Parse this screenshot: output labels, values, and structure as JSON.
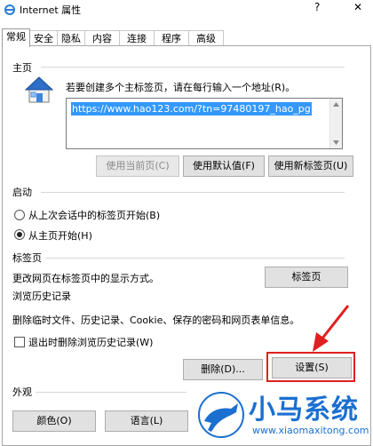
{
  "window": {
    "title": "Internet 属性",
    "help": "?",
    "close": "✕",
    "icon": "internet-explorer-icon"
  },
  "tabs": [
    {
      "label": "常规",
      "active": true
    },
    {
      "label": "安全"
    },
    {
      "label": "隐私"
    },
    {
      "label": "内容"
    },
    {
      "label": "连接"
    },
    {
      "label": "程序"
    },
    {
      "label": "高级"
    }
  ],
  "home": {
    "section": "主页",
    "hint": "若要创建多个主标签页，请在每行输入一个地址(R)。",
    "url": "https://www.hao123.com/?tn=97480197_hao_pg",
    "icon": "home-icon",
    "buttons": {
      "use_current": "使用当前页(C)",
      "use_default": "使用默认值(F)",
      "use_newtab": "使用新标签页(U)"
    }
  },
  "startup": {
    "section": "启动",
    "option1": "从上次会话中的标签页开始(B)",
    "option2": "从主页开始(H)",
    "selected": "option2"
  },
  "tabs_section": {
    "section": "标签页",
    "desc": "更改网页在标签页中的显示方式。",
    "button": "标签页"
  },
  "history": {
    "section": "浏览历史记录",
    "desc": "删除临时文件、历史记录、Cookie、保存的密码和网页表单信息。",
    "checkbox": "退出时删除浏览历史记录(W)",
    "checked": false,
    "delete_button": "删除(D)...",
    "settings_button": "设置(S)"
  },
  "appearance": {
    "section": "外观",
    "color_button": "颜色(O)",
    "language_button": "语言(L)"
  },
  "watermark": {
    "text": "小马系统",
    "url": "www.xiaomaxitong.com",
    "color": "#1b6fd0"
  },
  "annotation": {
    "color": "#e02020"
  }
}
